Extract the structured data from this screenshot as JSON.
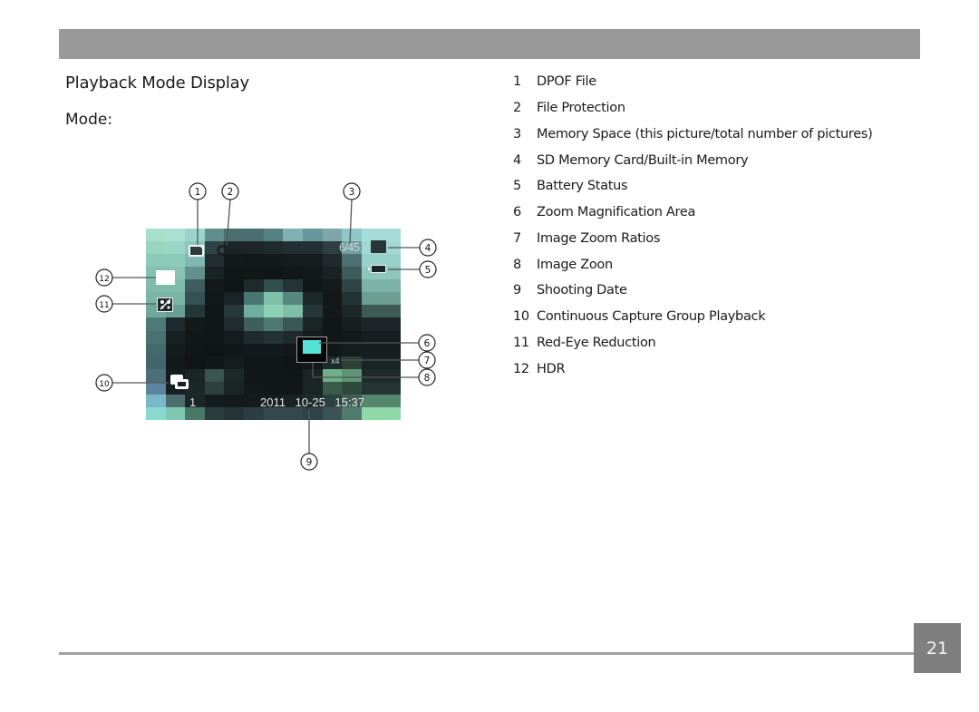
{
  "header": {
    "section_title": "Playback Mode Display",
    "mode_label": "Mode:"
  },
  "screen": {
    "counter": "6/45",
    "file_number": "1",
    "date": "2011 10-25 15:37",
    "zoom_ratio": "x4",
    "redeye_icon_text": "👁",
    "zoom_area_color": "#55e3d6"
  },
  "callouts": [
    "1",
    "2",
    "3",
    "4",
    "5",
    "6",
    "7",
    "8",
    "9",
    "10",
    "11",
    "12"
  ],
  "legend": [
    {
      "num": "1",
      "text": "DPOF File"
    },
    {
      "num": "2",
      "text": "File Protection"
    },
    {
      "num": "3",
      "text": "Memory Space (this picture/total number of pictures)"
    },
    {
      "num": "4",
      "text": "SD Memory Card/Built-in Memory"
    },
    {
      "num": "5",
      "text": "Battery Status"
    },
    {
      "num": "6",
      "text": "Zoom Magnification Area"
    },
    {
      "num": "7",
      "text": "Image Zoom Ratios"
    },
    {
      "num": "8",
      "text": "Image Zoon"
    },
    {
      "num": "9",
      "text": "Shooting Date"
    },
    {
      "num": "10",
      "text": "Continuous Capture Group Playback"
    },
    {
      "num": "11",
      "text": "Red-Eye Reduction"
    },
    {
      "num": "12",
      "text": "HDR"
    }
  ],
  "footer": {
    "page_number": "21"
  }
}
